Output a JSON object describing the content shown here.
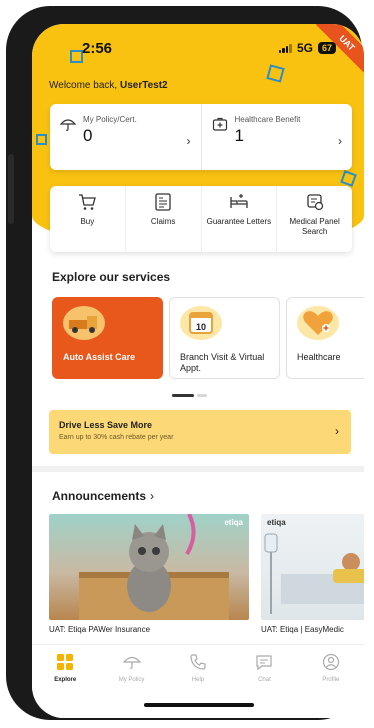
{
  "status_bar": {
    "time": "2:56",
    "network": "5G",
    "battery": "67"
  },
  "uat_badge": "UAT",
  "welcome": {
    "prefix": "Welcome back,",
    "username": "UserTest2"
  },
  "summary": [
    {
      "label": "My Policy/Cert.",
      "value": "0",
      "icon": "umbrella-icon"
    },
    {
      "label": "Healthcare Benefit",
      "value": "1",
      "icon": "medical-kit-icon"
    }
  ],
  "actions": [
    {
      "label": "Buy",
      "icon": "cart-icon"
    },
    {
      "label": "Claims",
      "icon": "claim-doc-icon"
    },
    {
      "label": "Guarantee Letters",
      "icon": "hospital-bed-icon"
    },
    {
      "label": "Medical Panel Search",
      "icon": "location-clinic-icon"
    }
  ],
  "services": {
    "title": "Explore our services",
    "items": [
      {
        "label": "Auto Assist Care",
        "icon": "tow-truck-icon"
      },
      {
        "label": "Branch Visit & Virtual Appt.",
        "icon": "calendar-icon",
        "calendar_day": "10"
      },
      {
        "label": "Healthcare",
        "icon": "heart-health-icon"
      }
    ]
  },
  "promo": {
    "title": "Drive Less Save More",
    "subtitle": "Earn up to 30% cash rebate per year"
  },
  "announcements": {
    "title": "Announcements",
    "items": [
      {
        "caption": "UAT: Etiqa PAWer Insurance",
        "brand": "etiqa"
      },
      {
        "caption": "UAT: Etiqa | EasyMedic",
        "brand": "etiqa"
      }
    ]
  },
  "tabs": [
    {
      "label": "Explore",
      "icon": "grid-icon",
      "active": true
    },
    {
      "label": "My Policy",
      "icon": "umbrella-icon",
      "active": false
    },
    {
      "label": "Help",
      "icon": "phone-icon",
      "active": false
    },
    {
      "label": "Chat",
      "icon": "chat-icon",
      "active": false
    },
    {
      "label": "Profile",
      "icon": "profile-icon",
      "active": false
    }
  ],
  "colors": {
    "brand_yellow": "#f9c211",
    "accent_orange": "#e8571b",
    "promo_bg": "#fcd876"
  }
}
